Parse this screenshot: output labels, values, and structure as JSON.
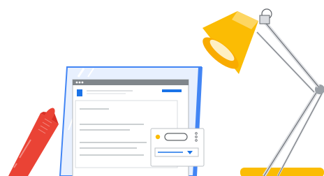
{
  "illustration": {
    "palette": {
      "board_frame": "#4285F4",
      "board_glass": "#CFE3FF",
      "page_background": "#FFFFFF",
      "page_border": "#BDC1C6",
      "text_lines": "#9AA0A6",
      "browser_bar": "#80868B",
      "accent_blue": "#1A73E8",
      "lamp_shade": "#FBBC04",
      "lamp_shade_light": "#FDD663",
      "lamp_arm": "#DADCE0",
      "lamp_arm_outline": "#5F6368",
      "pen_body": "#EA4335",
      "pen_cap_lines": "#F28B82",
      "toggle_dot": "#FBBC04"
    },
    "icons": [
      "document-board-icon",
      "desk-lamp-icon",
      "marker-pen-icon",
      "settings-card-icon"
    ]
  }
}
